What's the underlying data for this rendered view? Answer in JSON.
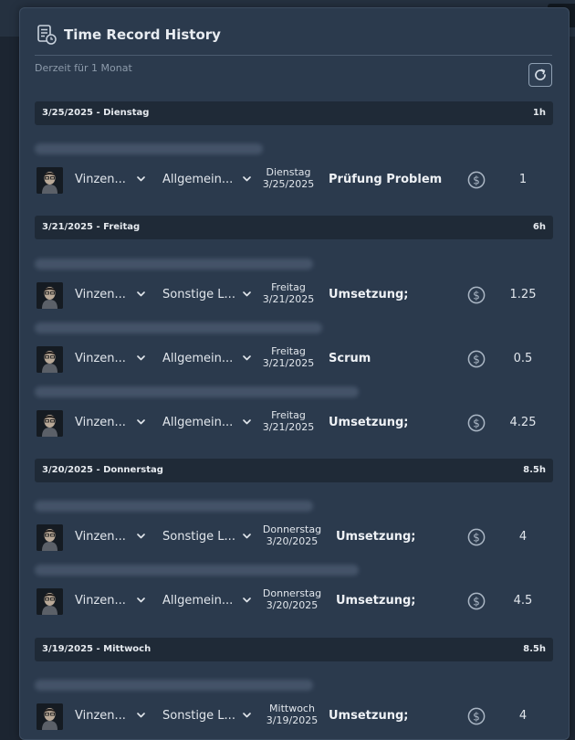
{
  "app": {
    "title": "Time Record History",
    "subtitle": "Derzeit für 1 Monat",
    "icons": {
      "title": "document-clock-icon",
      "refresh": "refresh-icon",
      "billable": "dollar-circle-icon",
      "dropdown": "chevron-down-icon"
    }
  },
  "days": [
    {
      "label": "3/25/2025 - Dienstag",
      "total": "1h",
      "entries": [
        {
          "user": "Vinzen...",
          "category": "Allgemein...",
          "weekday": "Dienstag",
          "date": "3/25/2025",
          "task": "Prüfung Problem",
          "hours": "1"
        }
      ]
    },
    {
      "label": "3/21/2025 - Freitag",
      "total": "6h",
      "entries": [
        {
          "user": "Vinzen...",
          "category": "Sonstige L...",
          "weekday": "Freitag",
          "date": "3/21/2025",
          "task": "Umsetzung;",
          "hours": "1.25"
        },
        {
          "user": "Vinzen...",
          "category": "Allgemein...",
          "weekday": "Freitag",
          "date": "3/21/2025",
          "task": "Scrum",
          "hours": "0.5"
        },
        {
          "user": "Vinzen...",
          "category": "Allgemein...",
          "weekday": "Freitag",
          "date": "3/21/2025",
          "task": "Umsetzung;",
          "hours": "4.25"
        }
      ]
    },
    {
      "label": "3/20/2025 - Donnerstag",
      "total": "8.5h",
      "entries": [
        {
          "user": "Vinzen...",
          "category": "Sonstige L...",
          "weekday": "Donnerstag",
          "date": "3/20/2025",
          "task": "Umsetzung;",
          "hours": "4"
        },
        {
          "user": "Vinzen...",
          "category": "Allgemein...",
          "weekday": "Donnerstag",
          "date": "3/20/2025",
          "task": "Umsetzung;",
          "hours": "4.5"
        }
      ]
    },
    {
      "label": "3/19/2025 - Mittwoch",
      "total": "8.5h",
      "entries": [
        {
          "user": "Vinzen...",
          "category": "Sonstige L...",
          "weekday": "Mittwoch",
          "date": "3/19/2025",
          "task": "Umsetzung;",
          "hours": "4"
        }
      ]
    }
  ]
}
